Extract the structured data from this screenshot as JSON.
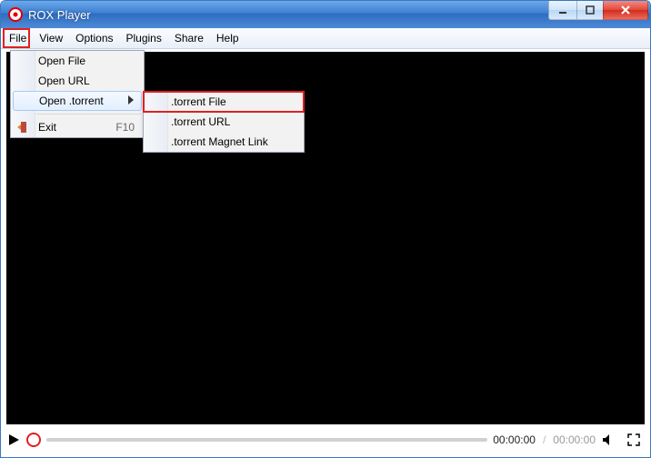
{
  "app": {
    "title": "ROX Player"
  },
  "menubar": {
    "items": [
      "File",
      "View",
      "Options",
      "Plugins",
      "Share",
      "Help"
    ]
  },
  "file_menu": {
    "open_file": "Open File",
    "open_url": "Open URL",
    "open_torrent": "Open .torrent",
    "exit": "Exit",
    "exit_accel": "F10"
  },
  "torrent_submenu": {
    "file": ".torrent File",
    "url": ".torrent URL",
    "magnet": ".torrent Magnet Link"
  },
  "controls": {
    "time_current": "00:00:00",
    "time_total": "00:00:00"
  }
}
